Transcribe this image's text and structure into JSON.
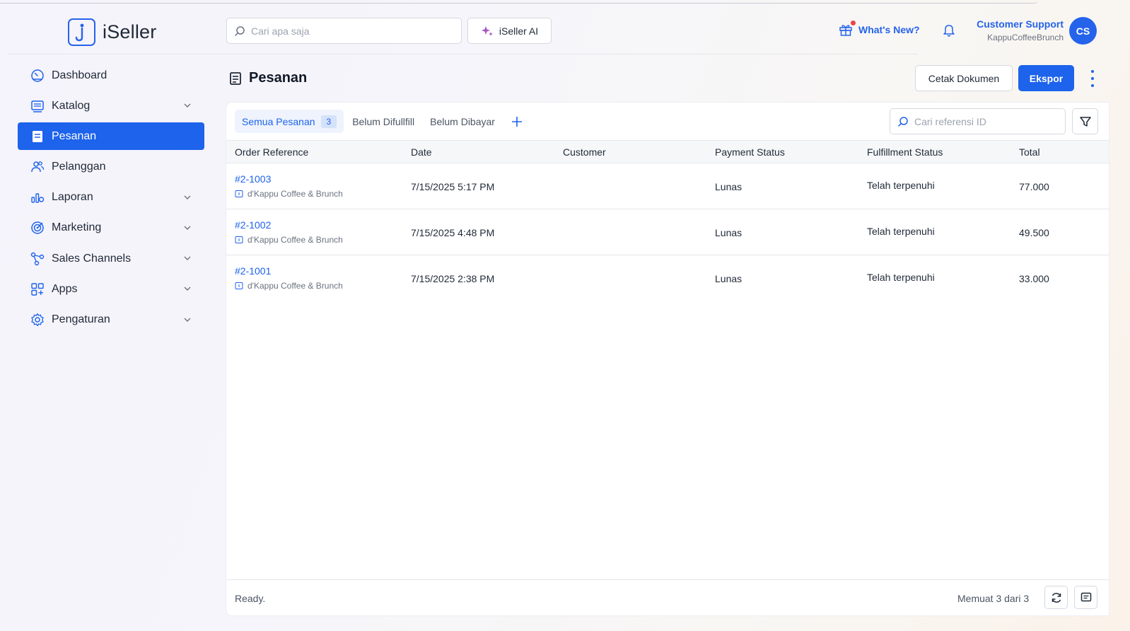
{
  "app": {
    "name": "iSeller"
  },
  "header": {
    "search_placeholder": "Cari apa saja",
    "ai_button": "iSeller AI",
    "whats_new": "What's New?",
    "user_name": "Customer Support",
    "store_name": "KappuCoffeeBrunch",
    "avatar_initials": "CS"
  },
  "sidebar": {
    "items": [
      {
        "label": "Dashboard",
        "icon": "dashboard-icon",
        "expandable": false,
        "active": false
      },
      {
        "label": "Katalog",
        "icon": "catalog-icon",
        "expandable": true,
        "active": false
      },
      {
        "label": "Pesanan",
        "icon": "orders-icon",
        "expandable": false,
        "active": true
      },
      {
        "label": "Pelanggan",
        "icon": "customers-icon",
        "expandable": false,
        "active": false
      },
      {
        "label": "Laporan",
        "icon": "reports-icon",
        "expandable": true,
        "active": false
      },
      {
        "label": "Marketing",
        "icon": "target-icon",
        "expandable": true,
        "active": false
      },
      {
        "label": "Sales Channels",
        "icon": "channels-icon",
        "expandable": true,
        "active": false
      },
      {
        "label": "Apps",
        "icon": "apps-icon",
        "expandable": true,
        "active": false
      },
      {
        "label": "Pengaturan",
        "icon": "gear-icon",
        "expandable": true,
        "active": false
      }
    ]
  },
  "page": {
    "title": "Pesanan",
    "print_button": "Cetak Dokumen",
    "export_button": "Ekspor"
  },
  "tabs": {
    "all_label": "Semua Pesanan",
    "all_count": "3",
    "unfulfilled_label": "Belum Difullfill",
    "unpaid_label": "Belum Dibayar"
  },
  "ref_search_placeholder": "Cari referensi ID",
  "table": {
    "columns": [
      "Order Reference",
      "Date",
      "Customer",
      "Payment Status",
      "Fulfillment Status",
      "Total"
    ],
    "rows": [
      {
        "ref": "#2-1003",
        "store": "d'Kappu Coffee & Brunch",
        "date": "7/15/2025 5:17 PM",
        "customer": "",
        "payment": "Lunas",
        "fulfillment": "Telah terpenuhi",
        "total": "77.000"
      },
      {
        "ref": "#2-1002",
        "store": "d'Kappu Coffee & Brunch",
        "date": "7/15/2025 4:48 PM",
        "customer": "",
        "payment": "Lunas",
        "fulfillment": "Telah terpenuhi",
        "total": "49.500"
      },
      {
        "ref": "#2-1001",
        "store": "d'Kappu Coffee & Brunch",
        "date": "7/15/2025 2:38 PM",
        "customer": "",
        "payment": "Lunas",
        "fulfillment": "Telah terpenuhi",
        "total": "33.000"
      }
    ]
  },
  "footer": {
    "status": "Ready.",
    "count": "Memuat 3 dari 3"
  },
  "colors": {
    "primary": "#1d63eb",
    "notification_dot": "#ef4444"
  }
}
